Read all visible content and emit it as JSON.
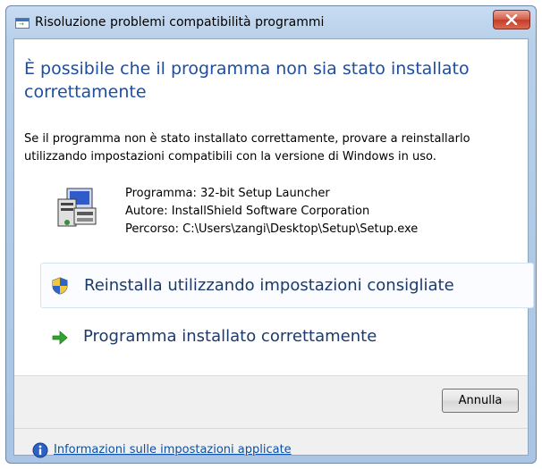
{
  "window": {
    "title": "Risoluzione problemi compatibilità programmi"
  },
  "heading": "È possibile che il programma non sia stato installato correttamente",
  "description": "Se il programma non è stato installato correttamente, provare a reinstallarlo utilizzando impostazioni compatibili con la versione di Windows in uso.",
  "program_info": {
    "program": "Programma: 32-bit Setup Launcher",
    "author": "Autore: InstallShield Software Corporation",
    "path": "Percorso: C:\\Users\\zangi\\Desktop\\Setup\\Setup.exe"
  },
  "options": {
    "reinstall_label": "Reinstalla utilizzando impostazioni consigliate",
    "installed_ok_label": "Programma installato correttamente"
  },
  "footer": {
    "cancel_label": "Annulla",
    "help_link": "Informazioni sulle impostazioni applicate"
  },
  "icons": {
    "app": "troubleshooter-icon",
    "close": "close-icon",
    "program": "setup-program-icon",
    "shield": "uac-shield-icon",
    "arrow": "green-arrow-icon",
    "info": "info-icon"
  },
  "colors": {
    "heading": "#1e4ea0",
    "link": "#0b4fa6",
    "close_button": "#c8432e",
    "arrow": "#2fa52f"
  }
}
